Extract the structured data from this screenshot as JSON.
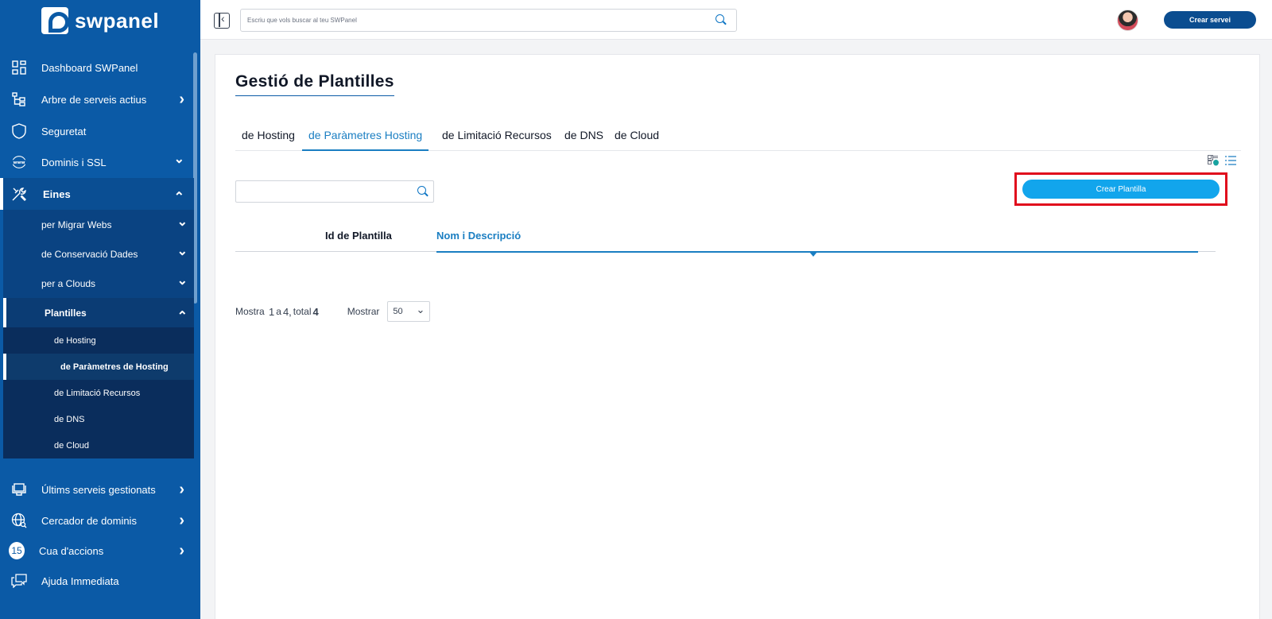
{
  "brand": {
    "name": "swpanel"
  },
  "sidebar": {
    "items": [
      {
        "label": "Dashboard SWPanel",
        "icon": "dashboard-icon"
      },
      {
        "label": "Arbre de serveis actius",
        "icon": "tree-icon"
      },
      {
        "label": "Seguretat",
        "icon": "shield-icon"
      },
      {
        "label": "Dominis i SSL",
        "icon": "www-icon"
      },
      {
        "label": "Eines",
        "icon": "tools-icon"
      }
    ],
    "eines_sub": [
      {
        "label": "per Migrar Webs"
      },
      {
        "label": "de Conservació Dades"
      },
      {
        "label": "per a Clouds"
      },
      {
        "label": "Plantilles"
      }
    ],
    "plantilles_sub": [
      {
        "label": "de Hosting"
      },
      {
        "label": "de Paràmetres de Hosting"
      },
      {
        "label": "de Limitació Recursos"
      },
      {
        "label": "de DNS"
      },
      {
        "label": "de Cloud"
      }
    ],
    "bottom_items": [
      {
        "label": "Últims serveis gestionats",
        "icon": "monitor-icon"
      },
      {
        "label": "Cercador de dominis",
        "icon": "globe-search-icon"
      },
      {
        "label": "Cua d'accions",
        "badge": "15"
      },
      {
        "label": "Ajuda Immediata",
        "icon": "chat-icon"
      }
    ]
  },
  "topbar": {
    "search_placeholder": "Escriu que vols buscar al teu SWPanel",
    "create_service": "Crear servei"
  },
  "main": {
    "title": "Gestió de Plantilles",
    "tabs": [
      {
        "label": "de Hosting"
      },
      {
        "label": "de Paràmetres Hosting",
        "active": true
      },
      {
        "label": "de Limitació Recursos"
      },
      {
        "label": "de DNS"
      },
      {
        "label": "de Cloud"
      }
    ],
    "create_button": "Crear Plantilla",
    "table": {
      "columns": [
        "Id de Plantilla",
        "Nom i Descripció"
      ]
    },
    "pagination": {
      "prefix": "Mostra",
      "from": "1",
      "sep": "a",
      "to": "4,",
      "total_label": "total",
      "total": "4",
      "show_label": "Mostrar",
      "page_size": "50"
    }
  },
  "colors": {
    "sidebar_bg": "#0b5aa6",
    "accent": "#1a7ec2",
    "button_blue": "#12a5ec",
    "highlight_red": "#e00b1c"
  }
}
